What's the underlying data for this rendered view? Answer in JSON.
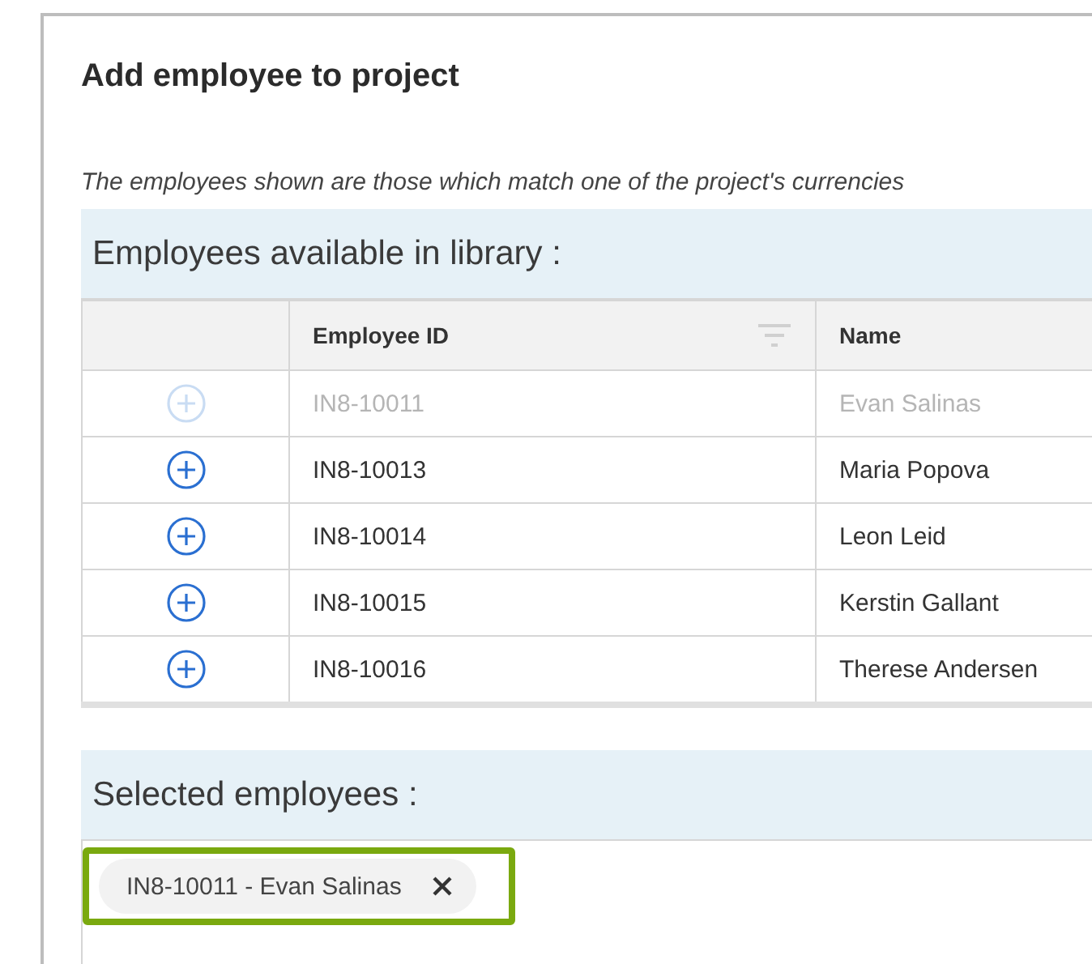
{
  "dialog": {
    "title": "Add employee to project",
    "note": "The employees shown are those which match one of the project's currencies",
    "library": {
      "heading": "Employees available in library :",
      "columns": [
        "Employee ID",
        "Name"
      ],
      "rows": [
        {
          "id": "IN8-10011",
          "name": "Evan Salinas",
          "disabled": true
        },
        {
          "id": "IN8-10013",
          "name": "Maria Popova",
          "disabled": false
        },
        {
          "id": "IN8-10014",
          "name": "Leon Leid",
          "disabled": false
        },
        {
          "id": "IN8-10015",
          "name": "Kerstin Gallant",
          "disabled": false
        },
        {
          "id": "IN8-10016",
          "name": "Therese Andersen",
          "disabled": false
        }
      ]
    },
    "selected": {
      "heading": "Selected employees :",
      "chips": [
        {
          "label": "IN8-10011 - Evan Salinas",
          "highlighted": true
        }
      ]
    }
  }
}
